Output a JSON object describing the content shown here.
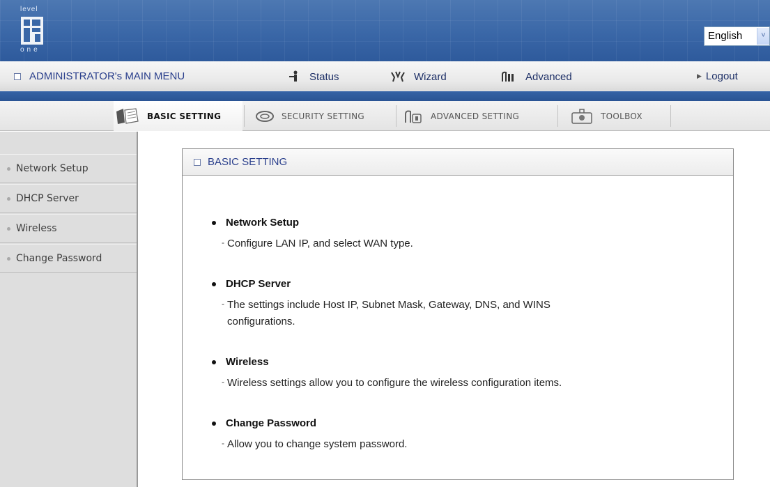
{
  "branding": {
    "logo_top": "level",
    "logo_bottom": "one"
  },
  "language_select": {
    "value": "English"
  },
  "main_menu": {
    "title": "ADMINISTRATOR's MAIN MENU",
    "status": "Status",
    "wizard": "Wizard",
    "advanced": "Advanced",
    "logout": "Logout"
  },
  "tabs": [
    {
      "label": "BASIC SETTING",
      "icon": "folder-icon",
      "active": true
    },
    {
      "label": "SECURITY SETTING",
      "icon": "lock-ring-icon",
      "active": false
    },
    {
      "label": "ADVANCED SETTING",
      "icon": "advanced-icon",
      "active": false
    },
    {
      "label": "TOOLBOX",
      "icon": "toolbox-icon",
      "active": false
    }
  ],
  "sidebar": {
    "items": [
      {
        "label": "Network Setup"
      },
      {
        "label": "DHCP Server"
      },
      {
        "label": "Wireless"
      },
      {
        "label": "Change Password"
      }
    ]
  },
  "panel": {
    "title": "BASIC SETTING",
    "entries": [
      {
        "title": "Network Setup",
        "desc_line1": "Configure LAN IP, and select WAN type.",
        "desc_line2": ""
      },
      {
        "title": "DHCP Server",
        "desc_line1": "The settings include Host IP, Subnet Mask, Gateway, DNS, and WINS",
        "desc_line2": "configurations."
      },
      {
        "title": "Wireless",
        "desc_line1": "Wireless settings allow you to configure the wireless configuration items.",
        "desc_line2": ""
      },
      {
        "title": "Change Password",
        "desc_line1": "Allow you to change system password.",
        "desc_line2": ""
      }
    ]
  },
  "colors": {
    "banner_blue": "#3a67a7",
    "menu_text": "#1d2f66",
    "sidebar_bg": "#dedede"
  }
}
